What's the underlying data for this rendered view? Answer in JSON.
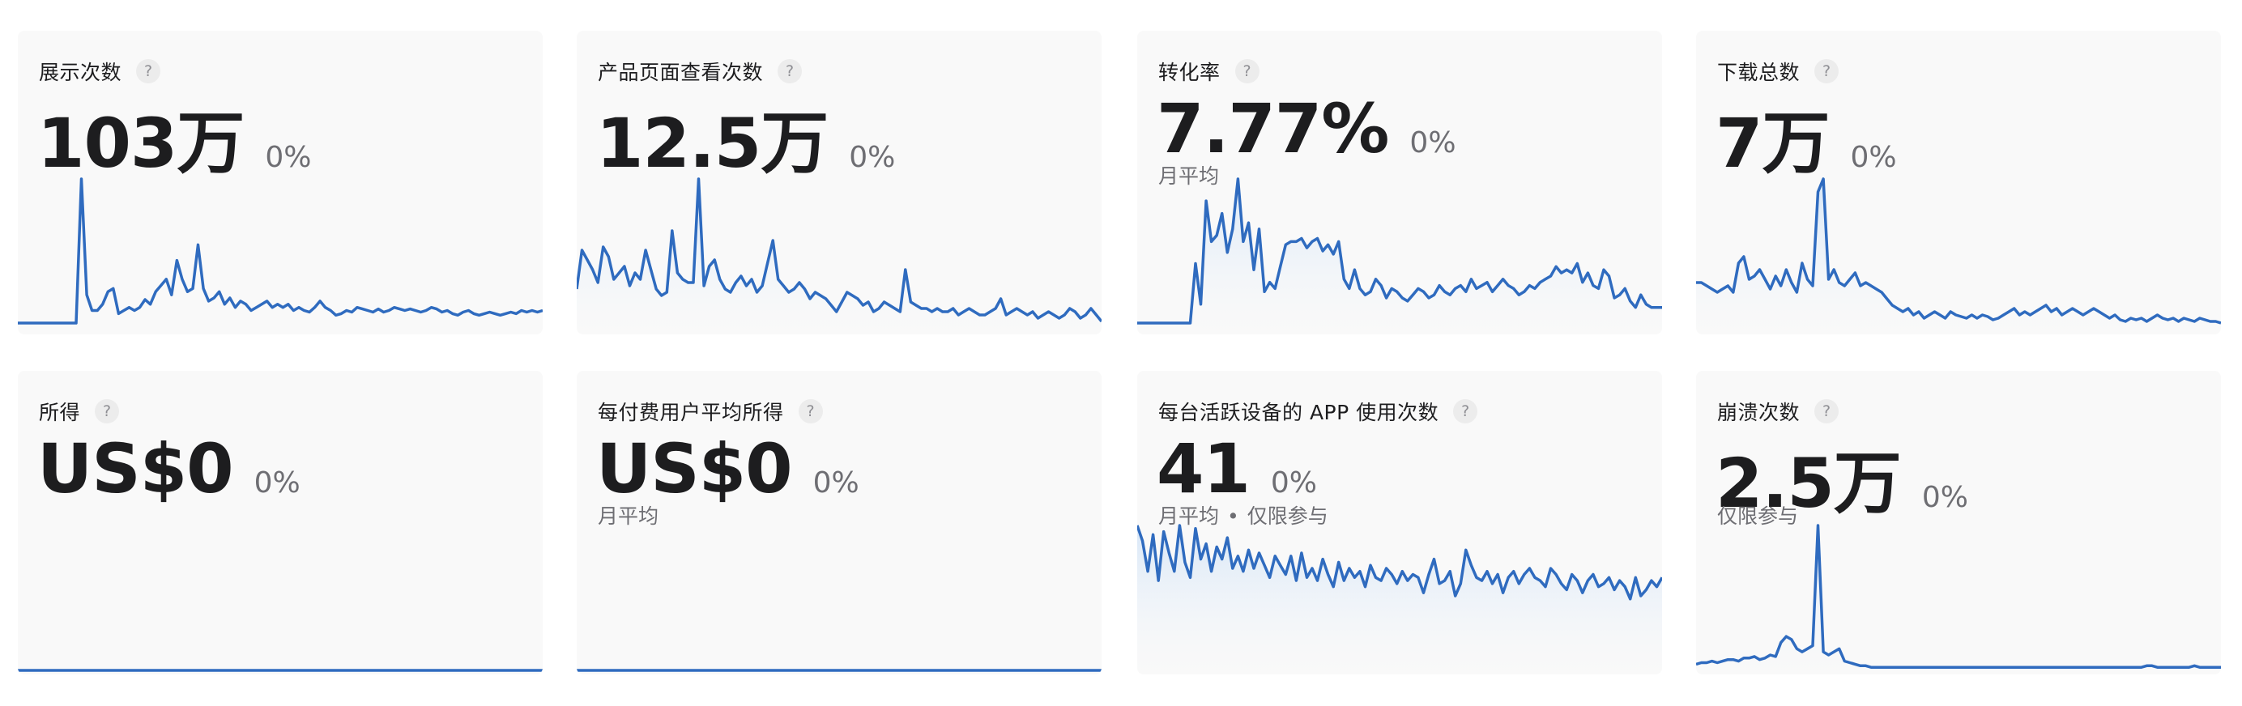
{
  "colors": {
    "line": "#2f6bbf",
    "area_top": "#d6e6f8",
    "card_bg": "#f9f9f9"
  },
  "help_glyph": "?",
  "metrics": [
    {
      "title": "展示次数",
      "value": "103万",
      "change": "0%",
      "series": [
        0,
        0,
        0,
        0,
        0,
        0,
        0,
        0,
        0,
        0,
        0,
        0,
        92,
        18,
        8,
        8,
        12,
        20,
        22,
        6,
        8,
        10,
        8,
        10,
        15,
        12,
        20,
        24,
        28,
        18,
        40,
        28,
        20,
        22,
        50,
        22,
        14,
        16,
        20,
        12,
        16,
        10,
        14,
        12,
        8,
        10,
        12,
        14,
        10,
        12,
        10,
        12,
        8,
        10,
        8,
        7,
        10,
        14,
        10,
        8,
        5,
        6,
        8,
        7,
        10,
        9,
        8,
        7,
        9,
        7,
        8,
        10,
        9,
        8,
        9,
        8,
        7,
        8,
        10,
        9,
        7,
        8,
        6,
        5,
        7,
        8,
        6,
        5,
        6,
        7,
        6,
        5,
        6,
        7,
        6,
        8,
        7,
        8,
        7,
        8
      ]
    },
    {
      "title": "产品页面查看次数",
      "value": "12.5万",
      "change": "0%",
      "series": [
        24,
        48,
        42,
        36,
        28,
        50,
        44,
        30,
        34,
        38,
        26,
        34,
        30,
        48,
        36,
        24,
        20,
        22,
        60,
        34,
        30,
        28,
        28,
        92,
        26,
        38,
        42,
        30,
        24,
        22,
        28,
        32,
        26,
        30,
        22,
        26,
        40,
        54,
        30,
        26,
        22,
        24,
        28,
        24,
        18,
        22,
        20,
        18,
        14,
        10,
        16,
        22,
        20,
        18,
        14,
        16,
        10,
        12,
        16,
        14,
        12,
        10,
        36,
        16,
        14,
        12,
        12,
        10,
        12,
        10,
        10,
        12,
        8,
        10,
        12,
        10,
        8,
        8,
        10,
        12,
        18,
        8,
        10,
        12,
        10,
        8,
        10,
        6,
        8,
        10,
        8,
        6,
        8,
        12,
        10,
        6,
        8,
        12,
        8,
        4
      ]
    },
    {
      "title": "转化率",
      "value": "7.77%",
      "change": "0%",
      "subtitle": "月平均",
      "subtitle2": "",
      "series": [
        0,
        0,
        0,
        0,
        0,
        0,
        0,
        0,
        0,
        0,
        0,
        38,
        12,
        78,
        52,
        56,
        70,
        45,
        60,
        92,
        52,
        64,
        34,
        60,
        20,
        26,
        22,
        36,
        50,
        52,
        52,
        54,
        48,
        52,
        54,
        46,
        50,
        44,
        52,
        28,
        22,
        34,
        22,
        18,
        20,
        28,
        24,
        16,
        22,
        20,
        16,
        14,
        18,
        22,
        20,
        16,
        18,
        24,
        20,
        18,
        22,
        24,
        20,
        28,
        22,
        24,
        26,
        20,
        24,
        28,
        24,
        22,
        18,
        20,
        24,
        22,
        26,
        28,
        30,
        36,
        32,
        34,
        32,
        38,
        26,
        32,
        24,
        22,
        34,
        30,
        16,
        18,
        22,
        14,
        10,
        18,
        12,
        10,
        10,
        10
      ]
    },
    {
      "title": "下载总数",
      "value": "7万",
      "change": "0%",
      "series": [
        28,
        28,
        26,
        24,
        22,
        24,
        26,
        22,
        40,
        44,
        30,
        32,
        36,
        30,
        24,
        32,
        26,
        36,
        28,
        22,
        40,
        30,
        26,
        84,
        92,
        30,
        36,
        28,
        26,
        30,
        34,
        26,
        28,
        26,
        24,
        22,
        18,
        14,
        12,
        10,
        12,
        8,
        10,
        6,
        8,
        10,
        8,
        6,
        10,
        8,
        7,
        6,
        8,
        6,
        8,
        7,
        5,
        6,
        8,
        10,
        12,
        8,
        10,
        8,
        10,
        12,
        14,
        10,
        12,
        8,
        10,
        12,
        10,
        8,
        10,
        12,
        10,
        8,
        6,
        8,
        5,
        4,
        6,
        5,
        6,
        4,
        6,
        8,
        6,
        5,
        6,
        4,
        6,
        5,
        4,
        6,
        5,
        4,
        4,
        3
      ]
    },
    {
      "title": "所得",
      "value": "US$0",
      "change": "0%",
      "series": [
        0,
        0
      ]
    },
    {
      "title": "每付费用户平均所得",
      "value": "US$0",
      "change": "0%",
      "subtitle": "月平均",
      "subtitle2": "",
      "series": [
        0,
        0
      ]
    },
    {
      "title": "每台活跃设备的 APP 使用次数",
      "value": "41",
      "change": "0%",
      "subtitle": "月平均",
      "subtitle2": "仅限参与",
      "series": [
        92,
        82,
        62,
        86,
        56,
        88,
        74,
        62,
        92,
        68,
        58,
        90,
        70,
        80,
        62,
        78,
        70,
        84,
        64,
        72,
        62,
        76,
        64,
        74,
        66,
        58,
        72,
        66,
        60,
        72,
        56,
        74,
        58,
        64,
        56,
        70,
        60,
        52,
        68,
        56,
        64,
        58,
        62,
        52,
        66,
        58,
        56,
        64,
        60,
        54,
        62,
        56,
        60,
        58,
        48,
        60,
        70,
        54,
        56,
        62,
        46,
        54,
        76,
        66,
        58,
        56,
        62,
        54,
        60,
        48,
        58,
        62,
        54,
        60,
        64,
        58,
        56,
        52,
        64,
        60,
        54,
        50,
        60,
        56,
        48,
        56,
        60,
        52,
        54,
        58,
        50,
        56,
        52,
        44,
        58,
        46,
        50,
        56,
        52,
        58
      ]
    },
    {
      "title": "崩溃次数",
      "value": "2.5万",
      "change": "0%",
      "subtitle": "仅限参与",
      "subtitle2": "",
      "series": [
        4,
        5,
        5,
        6,
        5,
        6,
        7,
        7,
        6,
        8,
        8,
        9,
        7,
        8,
        10,
        9,
        18,
        22,
        20,
        14,
        12,
        14,
        16,
        94,
        12,
        10,
        12,
        14,
        6,
        5,
        4,
        3,
        3,
        2,
        2,
        2,
        2,
        2,
        2,
        2,
        2,
        2,
        2,
        2,
        2,
        2,
        2,
        2,
        2,
        2,
        2,
        2,
        2,
        2,
        2,
        2,
        2,
        2,
        2,
        2,
        2,
        2,
        2,
        2,
        2,
        2,
        2,
        2,
        2,
        2,
        2,
        2,
        2,
        2,
        2,
        2,
        2,
        2,
        2,
        2,
        2,
        2,
        2,
        2,
        2,
        3,
        3,
        2,
        2,
        2,
        2,
        2,
        2,
        2,
        3,
        2,
        2,
        2,
        2,
        2
      ]
    }
  ]
}
